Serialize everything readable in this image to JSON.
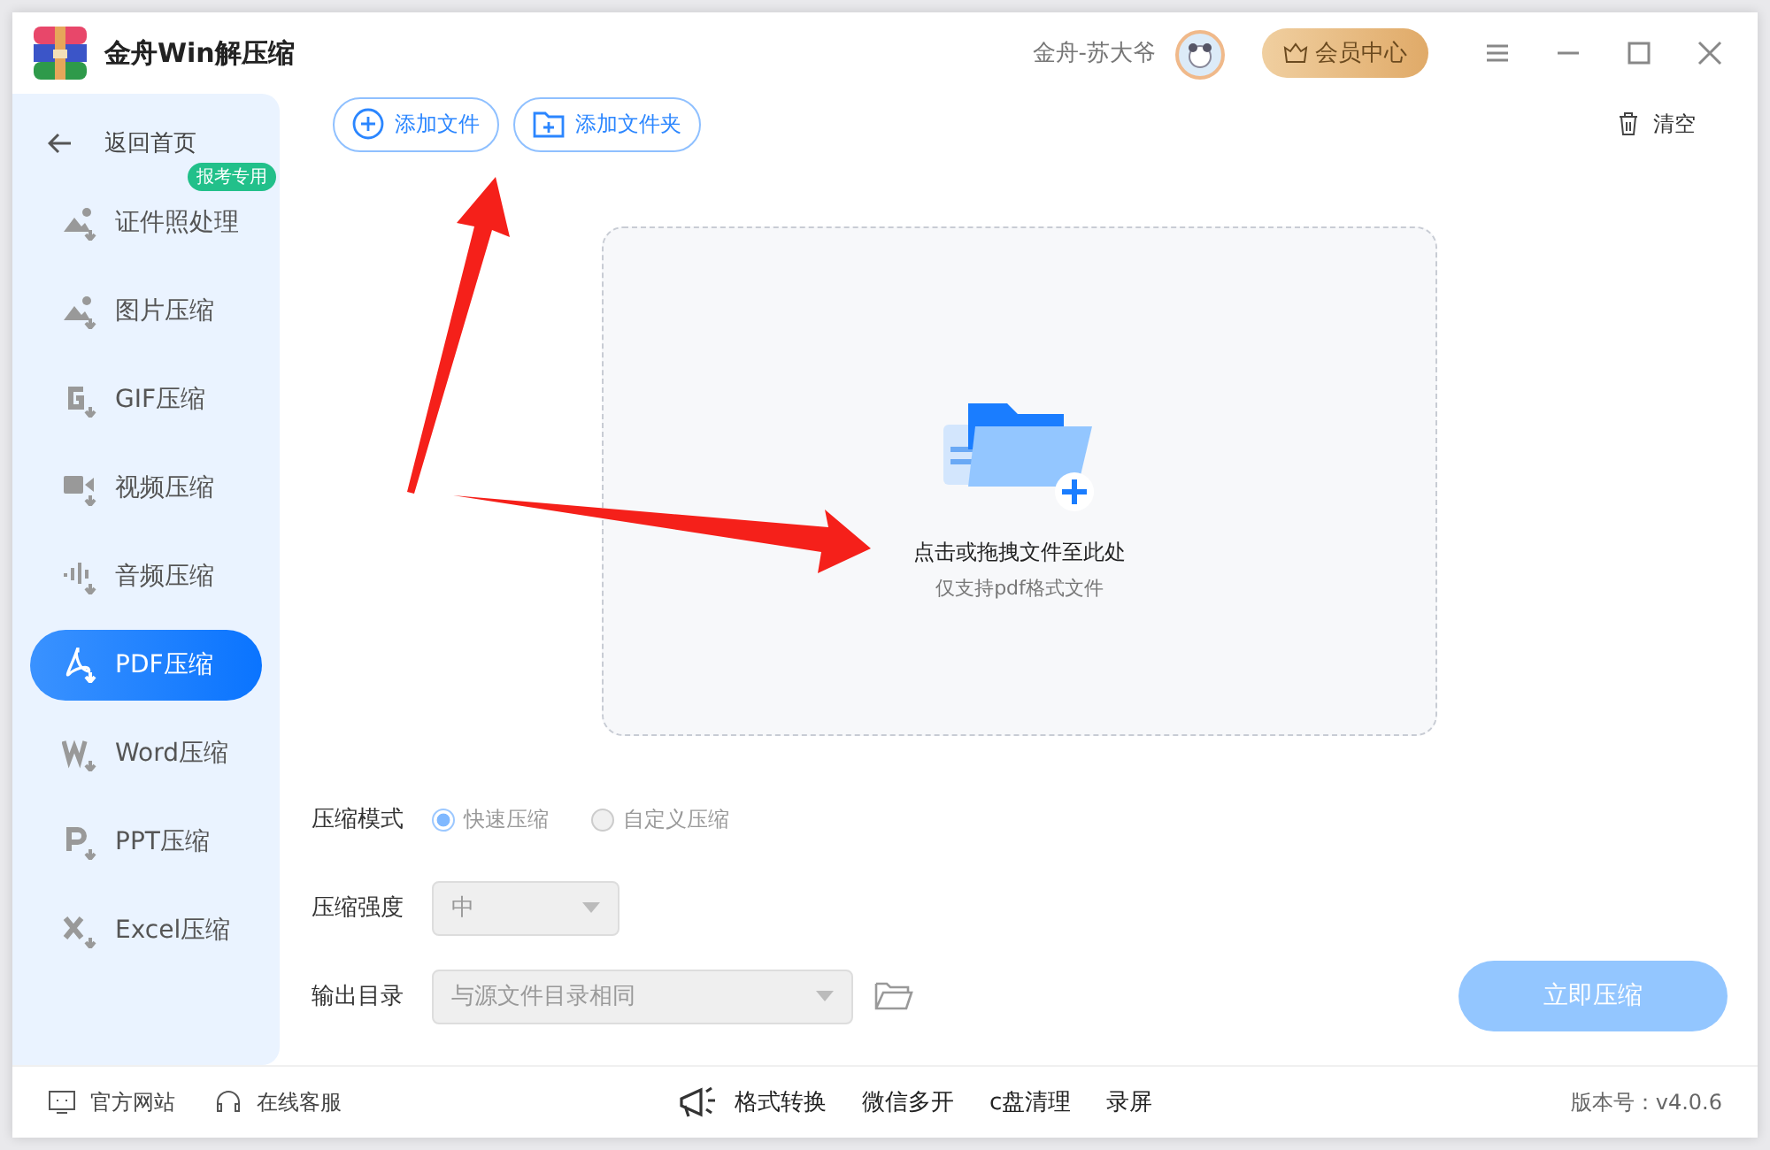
{
  "window": {
    "title": "金舟Win解压缩",
    "user": "金舟-苏大爷",
    "vip_button": "会员中心"
  },
  "sidebar": {
    "back": "返回首页",
    "items": [
      {
        "label": "证件照处理",
        "kind": "photo",
        "selected": false,
        "badge": "报考专用"
      },
      {
        "label": "图片压缩",
        "kind": "photo",
        "selected": false
      },
      {
        "label": "GIF压缩",
        "kind": "gif",
        "selected": false
      },
      {
        "label": "视频压缩",
        "kind": "video",
        "selected": false
      },
      {
        "label": "音频压缩",
        "kind": "audio",
        "selected": false
      },
      {
        "label": "PDF压缩",
        "kind": "pdf",
        "selected": true
      },
      {
        "label": "Word压缩",
        "kind": "word",
        "selected": false
      },
      {
        "label": "PPT压缩",
        "kind": "ppt",
        "selected": false
      },
      {
        "label": "Excel压缩",
        "kind": "excel",
        "selected": false
      }
    ]
  },
  "toolbar": {
    "add_file": "添加文件",
    "add_folder": "添加文件夹",
    "clear": "清空"
  },
  "drop_zone": {
    "title": "点击或拖拽文件至此处",
    "hint": "仅支持pdf格式文件"
  },
  "options": {
    "mode_label": "压缩模式",
    "modes": [
      {
        "label": "快速压缩",
        "selected": true
      },
      {
        "label": "自定义压缩",
        "selected": false
      }
    ],
    "strength_label": "压缩强度",
    "strength": {
      "value": "中",
      "disabled": true
    },
    "output_label": "输出目录",
    "output": {
      "value": "与源文件目录相同",
      "disabled": true
    }
  },
  "start_button": {
    "label": "立即压缩",
    "disabled": true
  },
  "footer": {
    "left": [
      "官方网站",
      "在线客服"
    ],
    "tools": [
      "格式转换",
      "微信多开",
      "c盘清理",
      "录屏"
    ],
    "version": "版本号：v4.0.6"
  }
}
